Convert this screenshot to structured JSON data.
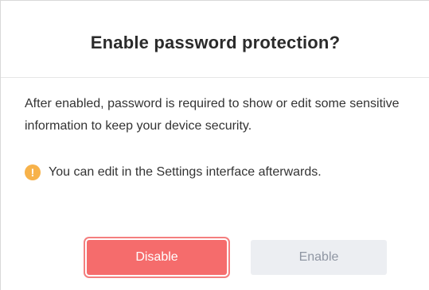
{
  "dialog": {
    "title": "Enable password protection?",
    "message": "After enabled, password is required to show or edit some sensitive information to keep your device security.",
    "notice": {
      "icon": "exclamation-icon",
      "text": "You can edit in the Settings interface afterwards."
    },
    "buttons": {
      "disable_label": "Disable",
      "enable_label": "Enable"
    }
  },
  "colors": {
    "primary_button": "#f56c6c",
    "primary_button_focus_ring": "#f47e7e",
    "secondary_button_bg": "#eceef2",
    "secondary_button_text": "#8f96a3",
    "warning_icon": "#f7b24a"
  }
}
